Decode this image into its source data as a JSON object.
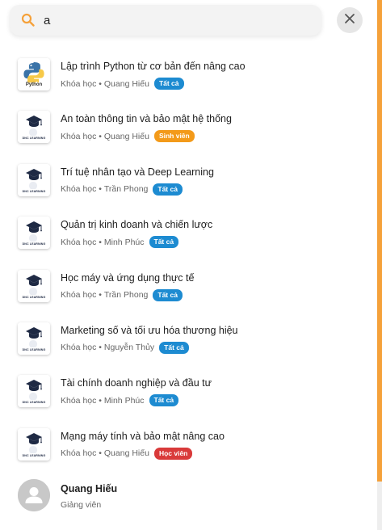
{
  "search": {
    "value": "a"
  },
  "results": [
    {
      "title": "Lập trình Python từ cơ bản đến nâng cao",
      "type": "Khóa học",
      "author": "Quang Hiếu",
      "badge": "Tất cả",
      "badge_color": "#1d8bd1",
      "thumb": "python",
      "thumb_label": "Python"
    },
    {
      "title": "An toàn thông tin và bảo mật hệ thống",
      "type": "Khóa học",
      "author": "Quang Hiếu",
      "badge": "Sinh viên",
      "badge_color": "#f39a1a",
      "thumb": "dnc",
      "thumb_label": "DNC LEARNING"
    },
    {
      "title": "Trí tuệ nhân tạo và Deep Learning",
      "type": "Khóa học",
      "author": "Trần Phong",
      "badge": "Tất cả",
      "badge_color": "#1d8bd1",
      "thumb": "dnc",
      "thumb_label": "DNC LEARNING"
    },
    {
      "title": "Quản trị kinh doanh và chiến lược",
      "type": "Khóa học",
      "author": "Minh Phúc",
      "badge": "Tất cả",
      "badge_color": "#1d8bd1",
      "thumb": "dnc",
      "thumb_label": "DNC LEARNING"
    },
    {
      "title": "Học máy và ứng dụng thực tế",
      "type": "Khóa học",
      "author": "Trần Phong",
      "badge": "Tất cả",
      "badge_color": "#1d8bd1",
      "thumb": "dnc",
      "thumb_label": "DNC LEARNING"
    },
    {
      "title": "Marketing số và tối ưu hóa thương hiệu",
      "type": "Khóa học",
      "author": "Nguyễn Thủy",
      "badge": "Tất cả",
      "badge_color": "#1d8bd1",
      "thumb": "dnc",
      "thumb_label": "DNC LEARNING"
    },
    {
      "title": "Tài chính doanh nghiệp và đầu tư",
      "type": "Khóa học",
      "author": "Minh Phúc",
      "badge": "Tất cả",
      "badge_color": "#1d8bd1",
      "thumb": "dnc",
      "thumb_label": "DNC LEARNING"
    },
    {
      "title": "Mạng máy tính và bảo mật nâng cao",
      "type": "Khóa học",
      "author": "Quang Hiếu",
      "badge": "Học viên",
      "badge_color": "#d93a3a",
      "thumb": "dnc",
      "thumb_label": "DNC LEARNING"
    }
  ],
  "person": {
    "name": "Quang Hiếu",
    "role": "Giảng viên",
    "icon": "user-avatar-icon"
  },
  "icons": {
    "search": "search-icon",
    "close": "close-icon",
    "course": "graduation-cap-icon"
  },
  "colors": {
    "accent": "#f5a13a",
    "badge_all": "#1d8bd1",
    "badge_student": "#f39a1a",
    "badge_learner": "#d93a3a"
  }
}
